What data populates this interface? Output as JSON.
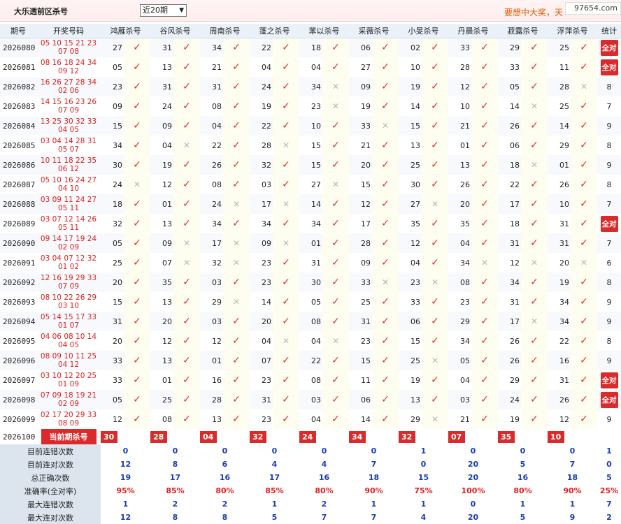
{
  "header": {
    "title": "大乐透前区杀号",
    "period_selected": "近20期",
    "slogan": "要想中大奖，天",
    "watermark": "97654.com"
  },
  "table": {
    "columns": [
      "期号",
      "开奖号码",
      "鸿雁杀号",
      "谷风杀号",
      "周南杀号",
      "蓬之杀号",
      "苯以杀号",
      "采薇杀号",
      "小旻杀号",
      "丹晨杀号",
      "菽露杀号",
      "浮萍杀号",
      "统计"
    ],
    "rows": [
      {
        "period": "2026080",
        "nums1": "05 10 15 21 23",
        "nums2": "07 08",
        "kills": [
          "27",
          "31",
          "34",
          "22",
          "18",
          "06",
          "02",
          "33",
          "29",
          "25"
        ],
        "marks": "1111111111",
        "stat": "全对"
      },
      {
        "period": "2026081",
        "nums1": "08 16 18 24 34",
        "nums2": "09 12",
        "kills": [
          "05",
          "13",
          "21",
          "04",
          "04",
          "27",
          "10",
          "28",
          "33",
          "11"
        ],
        "marks": "1111111111",
        "stat": "全对"
      },
      {
        "period": "2026082",
        "nums1": "16 26 27 28 34",
        "nums2": "02 06",
        "kills": [
          "23",
          "31",
          "31",
          "24",
          "34",
          "09",
          "19",
          "12",
          "05",
          "28"
        ],
        "marks": "1111011110",
        "stat": "8"
      },
      {
        "period": "2026083",
        "nums1": "14 15 16 23 26",
        "nums2": "07 09",
        "kills": [
          "09",
          "24",
          "08",
          "19",
          "23",
          "19",
          "14",
          "10",
          "14",
          "25"
        ],
        "marks": "1111011101",
        "stat": "7"
      },
      {
        "period": "2026084",
        "nums1": "13 25 30 32 33",
        "nums2": "04 05",
        "kills": [
          "15",
          "09",
          "04",
          "22",
          "10",
          "33",
          "15",
          "21",
          "26",
          "14"
        ],
        "marks": "1111101111",
        "stat": "9"
      },
      {
        "period": "2026085",
        "nums1": "03 04 14 28 31",
        "nums2": "05 07",
        "kills": [
          "34",
          "04",
          "22",
          "28",
          "15",
          "21",
          "13",
          "01",
          "06",
          "29"
        ],
        "marks": "1010111111",
        "stat": "8"
      },
      {
        "period": "2026086",
        "nums1": "10 11 18 22 35",
        "nums2": "06 12",
        "kills": [
          "30",
          "19",
          "26",
          "32",
          "15",
          "20",
          "25",
          "13",
          "18",
          "01"
        ],
        "marks": "1111111101",
        "stat": "9"
      },
      {
        "period": "2026087",
        "nums1": "05 10 16 24 27",
        "nums2": "04 10",
        "kills": [
          "24",
          "12",
          "08",
          "03",
          "27",
          "15",
          "30",
          "26",
          "22",
          "26"
        ],
        "marks": "0111011111",
        "stat": "8"
      },
      {
        "period": "2026088",
        "nums1": "03 09 11 24 27",
        "nums2": "05 11",
        "kills": [
          "18",
          "01",
          "24",
          "17",
          "14",
          "12",
          "27",
          "20",
          "17",
          "10"
        ],
        "marks": "1100110111",
        "stat": "7"
      },
      {
        "period": "2026089",
        "nums1": "03 07 12 14 26",
        "nums2": "05 11",
        "kills": [
          "32",
          "13",
          "34",
          "34",
          "34",
          "17",
          "35",
          "35",
          "18",
          "31"
        ],
        "marks": "1111111111",
        "stat": "全对"
      },
      {
        "period": "2026090",
        "nums1": "09 14 17 19 24",
        "nums2": "02 09",
        "kills": [
          "05",
          "09",
          "17",
          "09",
          "01",
          "28",
          "12",
          "04",
          "31",
          "31"
        ],
        "marks": "1000111111",
        "stat": "7"
      },
      {
        "period": "2026091",
        "nums1": "03 04 07 12 32",
        "nums2": "01 02",
        "kills": [
          "25",
          "07",
          "32",
          "23",
          "31",
          "09",
          "04",
          "34",
          "12",
          "20"
        ],
        "marks": "1001111000",
        "stat": "6"
      },
      {
        "period": "2026092",
        "nums1": "12 16 19 29 33",
        "nums2": "07 09",
        "kills": [
          "20",
          "35",
          "03",
          "23",
          "30",
          "33",
          "23",
          "08",
          "34",
          "19"
        ],
        "marks": "1111100111",
        "stat": "8"
      },
      {
        "period": "2026093",
        "nums1": "08 10 22 26 29",
        "nums2": "03 10",
        "kills": [
          "15",
          "13",
          "29",
          "14",
          "05",
          "25",
          "33",
          "23",
          "31",
          "34"
        ],
        "marks": "1101111111",
        "stat": "9"
      },
      {
        "period": "2026094",
        "nums1": "05 14 15 17 33",
        "nums2": "01 07",
        "kills": [
          "31",
          "20",
          "03",
          "20",
          "08",
          "31",
          "06",
          "29",
          "17",
          "34"
        ],
        "marks": "1111111101",
        "stat": "9"
      },
      {
        "period": "2026095",
        "nums1": "04 06 08 10 14",
        "nums2": "04 05",
        "kills": [
          "20",
          "12",
          "12",
          "04",
          "04",
          "23",
          "15",
          "34",
          "26",
          "22"
        ],
        "marks": "1110011111",
        "stat": "8"
      },
      {
        "period": "2026096",
        "nums1": "08 09 10 11 25",
        "nums2": "04 12",
        "kills": [
          "33",
          "13",
          "01",
          "07",
          "22",
          "15",
          "25",
          "05",
          "26",
          "16"
        ],
        "marks": "1111110111",
        "stat": "9"
      },
      {
        "period": "2026097",
        "nums1": "03 10 12 20 25",
        "nums2": "01 09",
        "kills": [
          "33",
          "01",
          "16",
          "23",
          "08",
          "11",
          "19",
          "04",
          "29",
          "31"
        ],
        "marks": "1111111111",
        "stat": "全对"
      },
      {
        "period": "2026098",
        "nums1": "07 09 18 19 21",
        "nums2": "02 09",
        "kills": [
          "05",
          "25",
          "28",
          "31",
          "03",
          "06",
          "13",
          "03",
          "24",
          "26"
        ],
        "marks": "1111111111",
        "stat": "全对"
      },
      {
        "period": "2026099",
        "nums1": "02 17 20 29 33",
        "nums2": "08 09",
        "kills": [
          "12",
          "08",
          "13",
          "23",
          "04",
          "14",
          "29",
          "21",
          "19",
          "12"
        ],
        "marks": "1111110111",
        "stat": "9"
      }
    ],
    "current": {
      "period": "2026100",
      "label": "当前期杀号",
      "kills": [
        "30",
        "28",
        "04",
        "32",
        "24",
        "34",
        "32",
        "07",
        "35",
        "10"
      ]
    },
    "stats": [
      {
        "label": "目前连错次数",
        "values": [
          "0",
          "0",
          "0",
          "0",
          "0",
          "0",
          "1",
          "0",
          "0",
          "0",
          "1"
        ]
      },
      {
        "label": "目前连对次数",
        "values": [
          "12",
          "8",
          "6",
          "4",
          "4",
          "7",
          "0",
          "20",
          "5",
          "7",
          "0"
        ]
      },
      {
        "label": "总正确次数",
        "values": [
          "19",
          "17",
          "16",
          "17",
          "16",
          "18",
          "15",
          "20",
          "16",
          "18",
          "5"
        ]
      },
      {
        "label": "准确率(全对率)",
        "values": [
          "95%",
          "85%",
          "80%",
          "85%",
          "80%",
          "90%",
          "75%",
          "100%",
          "80%",
          "90%",
          "25%"
        ]
      },
      {
        "label": "最大连错次数",
        "values": [
          "1",
          "2",
          "2",
          "1",
          "2",
          "1",
          "1",
          "0",
          "1",
          "1",
          "7"
        ]
      },
      {
        "label": "最大连对次数",
        "values": [
          "12",
          "8",
          "8",
          "5",
          "7",
          "7",
          "4",
          "20",
          "5",
          "9",
          "2"
        ]
      }
    ]
  },
  "marks": {
    "ok": "✓",
    "no": "✕"
  },
  "colors": {
    "accent_red": "#d92b2b",
    "mark_red": "#e0312e",
    "stat_blue": "#1a3fb0",
    "header_bg": "#eaf1f8",
    "slogan_orange": "#e05a00"
  }
}
